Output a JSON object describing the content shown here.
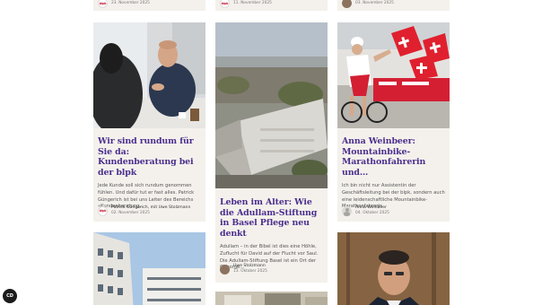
{
  "top_row": [
    {
      "date": "23. November 2025",
      "avatar": "blpk-logo"
    },
    {
      "date": "11. November 2025",
      "avatar": "blpk-logo"
    },
    {
      "date": "03. November 2025",
      "avatar": "photo"
    }
  ],
  "cards": [
    {
      "title": "Wir sind rundum für Sie da: Kundenberatung bei der blpk",
      "excerpt": "Jede Kunde soll sich rundum genommen fühlen. Und dafür tut er fast alles. Patrick Güngerich ist bei uns Leiter des Bereichs «Kundenberatung…",
      "author": "Patrick Güngerich, mit Uwe Stolzmann",
      "date": "02. November 2025",
      "avatar_text": "blpk"
    },
    {
      "title": "Leben im Alter: Wie die Adullam-Stiftung in Basel Pflege neu denkt",
      "excerpt": "Adullam – in der Bibel ist dies eine Höhle, Zuflucht für David auf der Flucht vor Saul. Die Adullam-Stiftung Basel ist ein Ort der Geborge…",
      "author": "Uwe Stolzmann",
      "date": "13. Oktober 2025"
    },
    {
      "title": "Anna Weinbeer: Mountainbike-Marathonfahrerin und…",
      "excerpt": "Ich bin nicht nur Assistentin der Geschäftsleitung bei der blpk, sondern auch eine leidenschaftliche Mountainbike-Marathonfahrerin",
      "author": "Anna Weinbeer",
      "date": "04. Oktober 2025"
    }
  ],
  "colors": {
    "title": "#4b2f8e",
    "card_bg": "#f4f1ec",
    "brand_red": "#c4122f"
  },
  "fab": {
    "label": "CD",
    "icon": "consent-icon"
  }
}
